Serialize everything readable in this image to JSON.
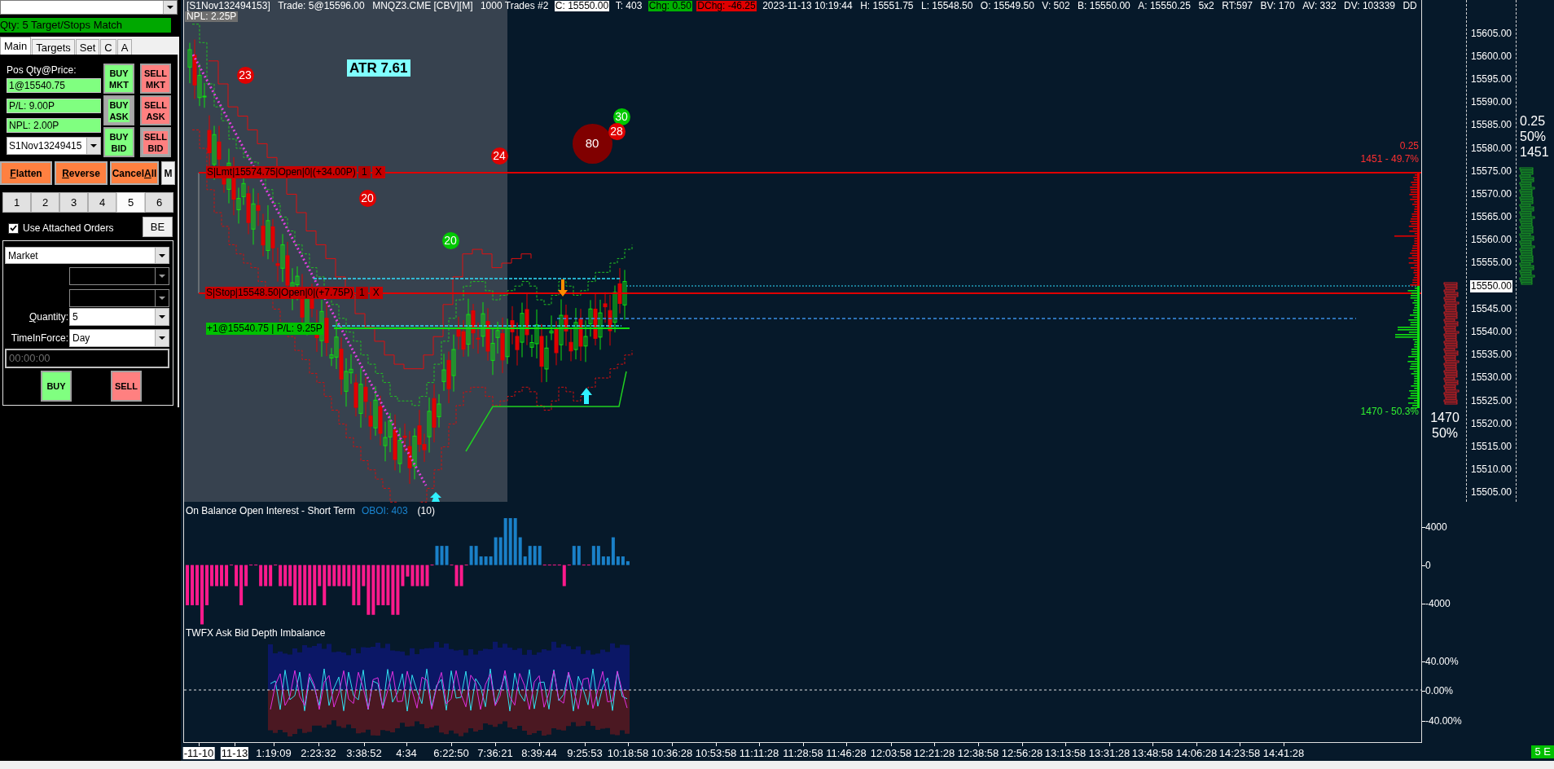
{
  "order_panel": {
    "status": "Qty: 5 Target/Stops Match",
    "tabs": [
      {
        "label": "Main",
        "selected": true
      },
      {
        "label": "Targets",
        "selected": false
      },
      {
        "label": "Set",
        "selected": false
      },
      {
        "label": "C",
        "selected": false
      },
      {
        "label": "A",
        "selected": false
      }
    ],
    "position_caption": "Pos Qty@Price:",
    "position_fields": [
      {
        "value": "1@15540.75"
      },
      {
        "value": "P/L: 9.00P"
      },
      {
        "value": "NPL: 2.00P"
      }
    ],
    "strategy_select": "S1Nov13249415",
    "order_buttons": [
      {
        "lines": [
          "BUY",
          "MKT"
        ],
        "color": "#80ff80",
        "kind": "solid"
      },
      {
        "lines": [
          "SELL",
          "MKT"
        ],
        "color": "#ff8080",
        "kind": "solid"
      },
      {
        "lines": [
          "BUY",
          "ASK"
        ],
        "color": "#80ff80",
        "kind": "highlight"
      },
      {
        "lines": [
          "SELL",
          "ASK"
        ],
        "color": "#ff8080",
        "kind": "solid"
      },
      {
        "lines": [
          "BUY",
          "BID"
        ],
        "color": "#80ff80",
        "kind": "solid"
      },
      {
        "lines": [
          "SELL",
          "BID"
        ],
        "color": "#ff8080",
        "kind": "highlight"
      }
    ],
    "action_buttons": [
      {
        "key": "F",
        "post": "latten"
      },
      {
        "key": "R",
        "post": "everse"
      },
      {
        "pre": "Cancel",
        "key": "A",
        "post": "ll"
      }
    ],
    "mode_button": "M",
    "quantity_presets": [
      {
        "label": "1",
        "selected": false
      },
      {
        "label": "2",
        "selected": false
      },
      {
        "label": "3",
        "selected": false
      },
      {
        "label": "4",
        "selected": false
      },
      {
        "label": "5",
        "selected": true
      },
      {
        "label": "6",
        "selected": false
      }
    ],
    "attached_orders": {
      "label": "Use Attached Orders",
      "checked": true
    },
    "breakeven_button": "BE",
    "order_type": "Market",
    "extra_selects": [
      {
        "disabled": true
      },
      {
        "disabled": true
      }
    ],
    "quantity": {
      "key": "Q",
      "post": "uantity:",
      "value": "5"
    },
    "time_in_force": {
      "label": "TimeInForce:",
      "value": "Day"
    },
    "time_field": {
      "value": "00:00:00",
      "disabled": true
    },
    "submit_buttons": [
      {
        "label": "BUY",
        "color": "#80ff80"
      },
      {
        "label": "SELL",
        "color": "#ff8080"
      }
    ]
  },
  "chart": {
    "info_bar": [
      {
        "text": "[S1Nov132494153]",
        "kind": "plain"
      },
      {
        "text": "Trade: 5@15596.00",
        "kind": "plain"
      },
      {
        "text": "MNQZ3.CME [CBV][M]",
        "kind": "plain"
      },
      {
        "text": "1000 Trades #2",
        "kind": "plain"
      },
      {
        "text": "C: 15550.00",
        "kind": "last"
      },
      {
        "text": "T: 403",
        "kind": "plain"
      },
      {
        "text": "Chg: 0.50",
        "kind": "up"
      },
      {
        "text": "DChg: -46.25",
        "kind": "down"
      },
      {
        "text": "2023-11-13 10:19:44",
        "kind": "plain"
      },
      {
        "text": "H: 15551.75",
        "kind": "plain"
      },
      {
        "text": "L: 15548.50",
        "kind": "plain"
      },
      {
        "text": "O: 15549.50",
        "kind": "plain"
      },
      {
        "text": "V: 502",
        "kind": "plain"
      },
      {
        "text": "B: 15550.00",
        "kind": "plain"
      },
      {
        "text": "A: 15550.25",
        "kind": "plain"
      },
      {
        "text": "5x2",
        "kind": "plain"
      },
      {
        "text": "RT:597",
        "kind": "plain"
      },
      {
        "text": "BV: 170",
        "kind": "plain"
      },
      {
        "text": "AV: 332",
        "kind": "plain"
      },
      {
        "text": "DV: 103339",
        "kind": "plain"
      },
      {
        "text": "DD",
        "kind": "plain"
      }
    ],
    "strategy_npl": "NPL: 2.25P",
    "atr": "ATR 7.61",
    "order_lines": [
      {
        "kind": "order",
        "text": "S|Lmt|15574.75|Open|0|(+34.00P)",
        "quantity": "1",
        "cancel": "X"
      },
      {
        "kind": "order",
        "text": "S|Stop|15548.50|Open|0|(+7.75P)",
        "quantity": "1",
        "cancel": "X"
      },
      {
        "kind": "position",
        "text": "+1@15540.75 | P/L: 9.25P"
      }
    ],
    "bubbles": [
      {
        "label": "23",
        "color": "#e00000",
        "kind": "small"
      },
      {
        "label": "30",
        "color": "#00c800",
        "kind": "small"
      },
      {
        "label": "80",
        "color": "#800000",
        "kind": "large"
      },
      {
        "label": "28",
        "color": "#e00000",
        "kind": "small"
      },
      {
        "label": "24",
        "color": "#e00000",
        "kind": "small"
      },
      {
        "label": "20",
        "color": "#e00000",
        "kind": "small"
      },
      {
        "label": "20",
        "color": "#00c800",
        "kind": "small"
      }
    ],
    "profile_labels": [
      {
        "text": "0.25",
        "color": "#ff3030"
      },
      {
        "text": "1451 - 49.7%",
        "color": "#ff3030"
      },
      {
        "text": "1470 - 50.3%",
        "color": "#30f030"
      }
    ],
    "price_axis": [
      {
        "text": "15605.00",
        "kind": "tick"
      },
      {
        "text": "15600.00",
        "kind": "tick"
      },
      {
        "text": "15595.00",
        "kind": "tick"
      },
      {
        "text": "15590.00",
        "kind": "tick"
      },
      {
        "text": "15585.00",
        "kind": "tick"
      },
      {
        "text": "15580.00",
        "kind": "tick"
      },
      {
        "text": "15575.00",
        "kind": "tick"
      },
      {
        "text": "15570.00",
        "kind": "tick"
      },
      {
        "text": "15565.00",
        "kind": "tick"
      },
      {
        "text": "15560.00",
        "kind": "tick"
      },
      {
        "text": "15555.00",
        "kind": "tick"
      },
      {
        "text": "15550.00",
        "kind": "last"
      },
      {
        "text": "15545.00",
        "kind": "tick"
      },
      {
        "text": "15540.00",
        "kind": "tick"
      },
      {
        "text": "15535.00",
        "kind": "tick"
      },
      {
        "text": "15530.00",
        "kind": "tick"
      },
      {
        "text": "15525.00",
        "kind": "tick"
      },
      {
        "text": "15520.00",
        "kind": "tick"
      },
      {
        "text": "15515.00",
        "kind": "tick"
      },
      {
        "text": "15510.00",
        "kind": "tick"
      },
      {
        "text": "15505.00",
        "kind": "tick"
      }
    ],
    "ask_summary": [
      "0.25",
      "50%",
      "1451"
    ],
    "bid_summary": [
      "1470",
      "50%"
    ],
    "oboi": {
      "title": "On Balance Open Interest - Short Term",
      "value_label": "OBOI: 403",
      "period": "(10)",
      "axis": [
        "4000",
        "0",
        "-4000"
      ]
    },
    "imbalance": {
      "title": "TWFX Ask Bid Depth Imbalance",
      "axis": [
        "40.00%",
        "0.00%",
        "-40.00%"
      ]
    },
    "time_axis": [
      {
        "text": "-11-10",
        "kind": "date"
      },
      {
        "text": "11-13",
        "kind": "date"
      },
      {
        "text": "1:19:09",
        "kind": "time"
      },
      {
        "text": "2:23:32",
        "kind": "time"
      },
      {
        "text": "3:38:52",
        "kind": "time"
      },
      {
        "text": "4:34",
        "kind": "time"
      },
      {
        "text": "6:22:50",
        "kind": "time"
      },
      {
        "text": "7:36:21",
        "kind": "time"
      },
      {
        "text": "8:39:44",
        "kind": "time"
      },
      {
        "text": "9:25:53",
        "kind": "time"
      },
      {
        "text": "10:18:58",
        "kind": "time"
      },
      {
        "text": "10:36:28",
        "kind": "time"
      },
      {
        "text": "10:53:58",
        "kind": "time"
      },
      {
        "text": "11:11:28",
        "kind": "time"
      },
      {
        "text": "11:28:58",
        "kind": "time"
      },
      {
        "text": "11:46:28",
        "kind": "time"
      },
      {
        "text": "12:03:58",
        "kind": "time"
      },
      {
        "text": "12:21:28",
        "kind": "time"
      },
      {
        "text": "12:38:58",
        "kind": "time"
      },
      {
        "text": "12:56:28",
        "kind": "time"
      },
      {
        "text": "13:13:58",
        "kind": "time"
      },
      {
        "text": "13:31:28",
        "kind": "time"
      },
      {
        "text": "13:48:58",
        "kind": "time"
      },
      {
        "text": "14:06:28",
        "kind": "time"
      },
      {
        "text": "14:23:58",
        "kind": "time"
      },
      {
        "text": "14:41:28",
        "kind": "time"
      }
    ],
    "status_badge": "5 E"
  }
}
